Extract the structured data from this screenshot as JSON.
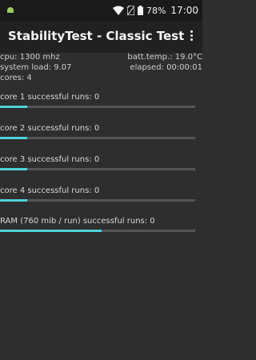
{
  "status_bar": {
    "battery": "78%",
    "time": "17:00",
    "icons": [
      "android-icon",
      "wifi-icon",
      "no-sim-icon",
      "battery-icon"
    ]
  },
  "app_bar": {
    "title": "StabilityTest - Classic Test",
    "menu_icon": "overflow-menu-icon"
  },
  "info": {
    "cpu": "cpu: 1300 mhz",
    "batt_temp": "batt.temp.: 19.0°C",
    "system_load": "system load: 9.07",
    "elapsed": "elapsed: 00:00:01",
    "cores": "cores: 4"
  },
  "tests": [
    {
      "label": "core 1 successful runs: 0",
      "progress": 0.14
    },
    {
      "label": "core 2 successful runs: 0",
      "progress": 0.14
    },
    {
      "label": "core 3 successful runs: 0",
      "progress": 0.14
    },
    {
      "label": "core 4 successful runs: 0",
      "progress": 0.14
    },
    {
      "label": "RAM (760 mib / run) successful runs: 0",
      "progress": 0.52
    }
  ],
  "colors": {
    "accent": "#4fd1d9",
    "track": "#555555",
    "background": "#2e2e2e"
  }
}
